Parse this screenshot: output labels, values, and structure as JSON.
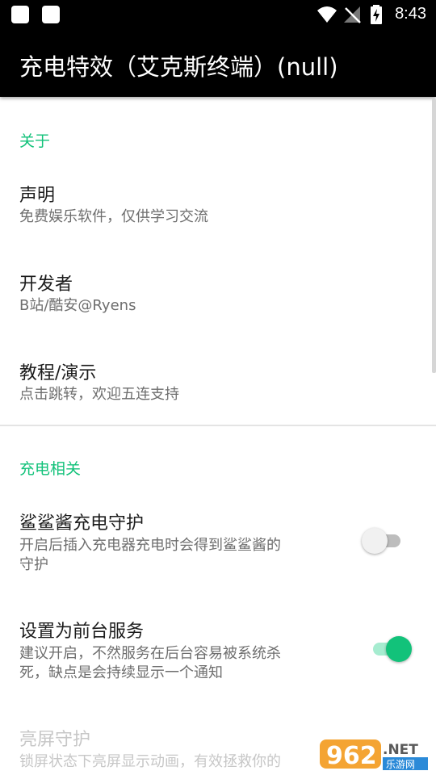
{
  "status_bar": {
    "time": "8:43"
  },
  "app_bar": {
    "title": "充电特效（艾克斯终端）(null)"
  },
  "sections": [
    {
      "header": "关于",
      "items": [
        {
          "title": "声明",
          "subtitle": "免费娱乐软件，仅供学习交流"
        },
        {
          "title": "开发者",
          "subtitle": "B站/酷安@Ryens"
        },
        {
          "title": "教程/演示",
          "subtitle": "点击跳转，欢迎五连支持"
        }
      ]
    },
    {
      "header": "充电相关",
      "items": [
        {
          "title": "鲨鲨酱充电守护",
          "subtitle_line1": "开启后插入充电器充电时会得到鲨鲨酱的",
          "subtitle_line2": "守护",
          "switch_on": false
        },
        {
          "title": "设置为前台服务",
          "subtitle_line1": "建议开启，不然服务在后台容易被系统杀",
          "subtitle_line2": "死，缺点是会持续显示一个通知",
          "switch_on": true
        },
        {
          "title": "亮屏守护",
          "subtitle_line1": "锁屏状态下亮屏显示动画，有效拯救你的",
          "enabled": false
        }
      ]
    }
  ],
  "watermark": {
    "number": "962",
    "suffix": ".NET",
    "site": "乐游网"
  },
  "colors": {
    "accent": "#12c27a",
    "switch_off_track": "#bdbdbd",
    "switch_on_track": "#a6ecd0"
  }
}
